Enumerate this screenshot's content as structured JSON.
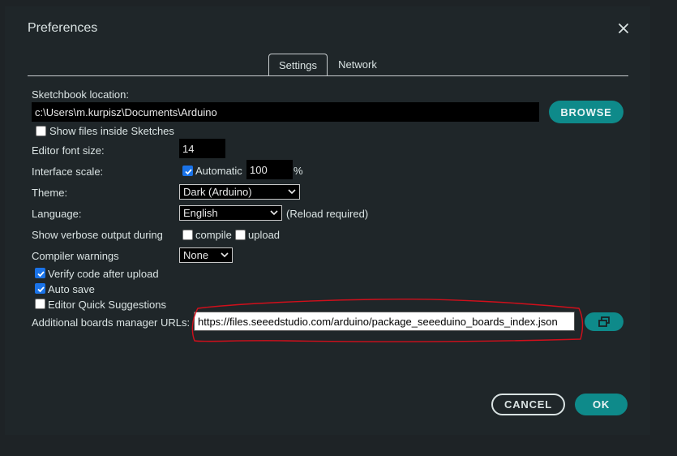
{
  "dialog": {
    "title": "Preferences",
    "close_icon": "close-icon"
  },
  "tabs": [
    {
      "label": "Settings",
      "active": true
    },
    {
      "label": "Network",
      "active": false
    }
  ],
  "sketchbook": {
    "label": "Sketchbook location:",
    "value": "c:\\Users\\m.kurpisz\\Documents\\Arduino",
    "browse_label": "BROWSE",
    "show_files_label": "Show files inside Sketches",
    "show_files_checked": false
  },
  "editor_font": {
    "label": "Editor font size:",
    "value": "14"
  },
  "interface_scale": {
    "label": "Interface scale:",
    "automatic_label": "Automatic",
    "automatic_checked": true,
    "value": "100",
    "unit": "%"
  },
  "theme": {
    "label": "Theme:",
    "selected": "Dark (Arduino)"
  },
  "language": {
    "label": "Language:",
    "selected": "English",
    "note": "(Reload required)"
  },
  "verbose": {
    "label": "Show verbose output during",
    "compile_label": "compile",
    "compile_checked": false,
    "upload_label": "upload",
    "upload_checked": false
  },
  "compiler_warnings": {
    "label": "Compiler warnings",
    "selected": "None"
  },
  "options": {
    "verify_label": "Verify code after upload",
    "verify_checked": true,
    "autosave_label": "Auto save",
    "autosave_checked": true,
    "quick_suggestions_label": "Editor Quick Suggestions",
    "quick_suggestions_checked": false
  },
  "boards_urls": {
    "label": "Additional boards manager URLs:",
    "value": "https://files.seeedstudio.com/arduino/package_seeeduino_boards_index.json",
    "open_icon": "open-window-icon"
  },
  "footer": {
    "cancel_label": "CANCEL",
    "ok_label": "OK"
  },
  "colors": {
    "accent": "#0e8a8a",
    "background": "#1f2629",
    "annotation": "#d10f1b"
  }
}
